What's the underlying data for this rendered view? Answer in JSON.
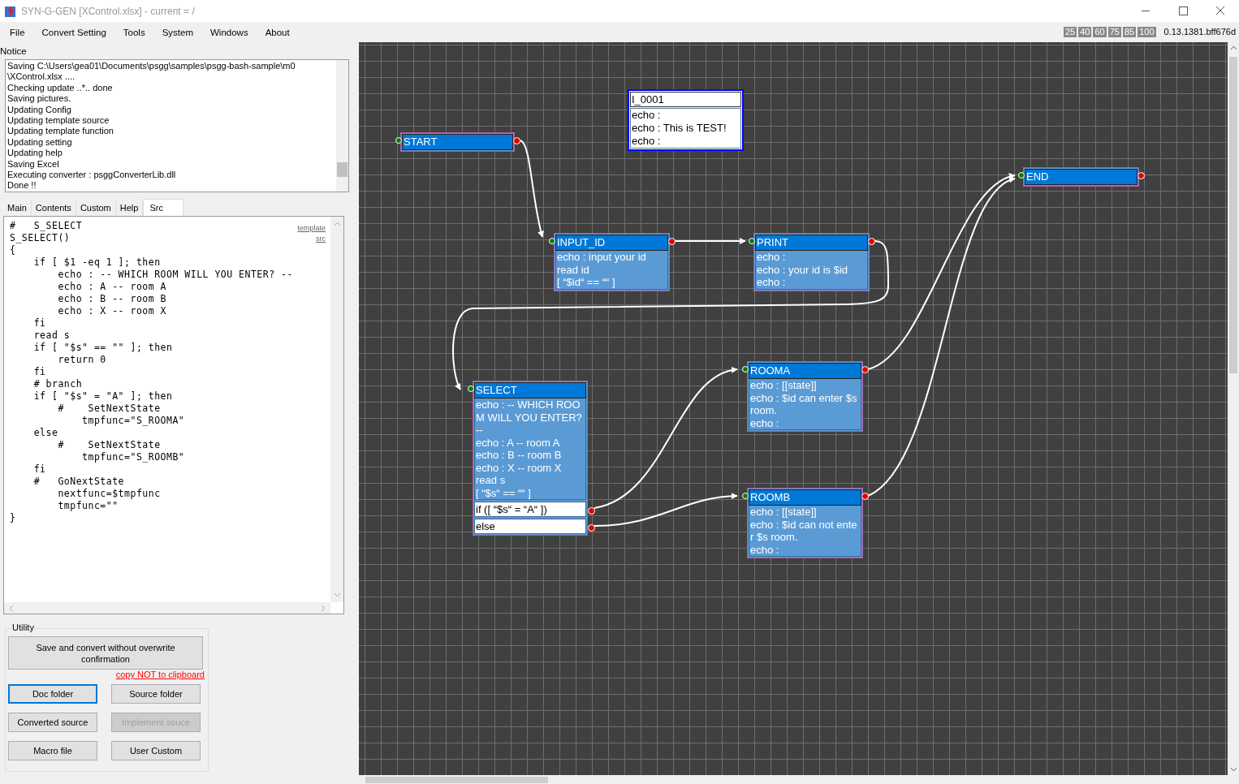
{
  "window": {
    "title": "SYN-G-GEN  [XControl.xlsx] - current = /"
  },
  "menu": [
    "File",
    "Convert Setting",
    "Tools",
    "System",
    "Windows",
    "About"
  ],
  "zoom_levels": [
    "25",
    "40",
    "60",
    "75",
    "85",
    "100"
  ],
  "version": "0.13.1381.bff676d",
  "notice": {
    "label": "Notice",
    "lines": [
      "Saving C:\\Users\\gea01\\Documents\\psgg\\samples\\psgg-bash-sample\\m0",
      "\\XControl.xlsx ....",
      "Checking update ..*.. done",
      "Saving pictures.",
      "Updating Config",
      "Updating template source",
      "Updating template function",
      "Updating setting",
      "Updating help",
      "Saving Excel",
      "Executing converter : psggConverterLib.dll",
      "Done !!"
    ]
  },
  "tabs": [
    {
      "label": "Main",
      "selected": false
    },
    {
      "label": "Contents",
      "selected": false
    },
    {
      "label": "Custom",
      "selected": false
    },
    {
      "label": "Help",
      "selected": false
    },
    {
      "label": "Src",
      "selected": true
    }
  ],
  "source": {
    "links": [
      "template",
      "src"
    ],
    "code_lines": [
      "#   S_SELECT",
      "S_SELECT()",
      "{",
      "    if [ $1 -eq 1 ]; then",
      "        echo : -- WHICH ROOM WILL YOU ENTER? --",
      "        echo : A -- room A",
      "        echo : B -- room B",
      "        echo : X -- room X",
      "    fi",
      "    read s",
      "    if [ \"$s\" == \"\" ]; then",
      "        return 0",
      "    fi",
      "    # branch",
      "    if [ \"$s\" = \"A\" ]; then",
      "        #    SetNextState",
      "            tmpfunc=\"S_ROOMA\"",
      "    else",
      "        #    SetNextState",
      "            tmpfunc=\"S_ROOMB\"",
      "    fi",
      "    #   GoNextState",
      "        nextfunc=$tmpfunc",
      "        tmpfunc=\"\"",
      "}"
    ]
  },
  "utility": {
    "label": "Utility",
    "main_button": "Save and convert without overwrite confirmation",
    "link": "copy NOT to clipboard",
    "buttons": [
      {
        "label": "Doc folder",
        "focused": true,
        "disabled": false
      },
      {
        "label": "Source folder",
        "focused": false,
        "disabled": false
      },
      {
        "label": "Converted source",
        "focused": false,
        "disabled": false
      },
      {
        "label": "Implement souce",
        "focused": false,
        "disabled": true
      },
      {
        "label": "Macro file",
        "focused": false,
        "disabled": false
      },
      {
        "label": "User Custom",
        "focused": false,
        "disabled": false
      }
    ]
  },
  "canvas": {
    "nodes": [
      {
        "kind": "terminal",
        "title": "START"
      },
      {
        "kind": "comment",
        "title": "I_0001",
        "lines": [
          "echo :",
          "echo : This is TEST!",
          "echo :"
        ]
      },
      {
        "kind": "state",
        "title": "INPUT_ID",
        "lines": [
          "echo : input your id",
          "read id",
          "[ “$id“ == ““ ]"
        ]
      },
      {
        "kind": "state",
        "title": "PRINT",
        "lines": [
          "echo :",
          "echo : your id is $id",
          "echo :"
        ]
      },
      {
        "kind": "terminal",
        "title": "END"
      },
      {
        "kind": "state",
        "title": "SELECT",
        "lines": [
          "echo : -- WHICH ROOM WILL YOU ENTER? --",
          "echo : A -- room A",
          "echo : B -- room B",
          "echo : X -- room X",
          "read s",
          "[ “$s“ == ““ ]"
        ],
        "branches": [
          "if ([ “$s“ = “A“ ])",
          "else"
        ]
      },
      {
        "kind": "state",
        "title": "ROOMA",
        "lines": [
          "echo : [[state]]",
          "echo : $id can enter $s room.",
          "echo :"
        ]
      },
      {
        "kind": "state",
        "title": "ROOMB",
        "lines": [
          "echo : [[state]]",
          "echo : $id can not enter $s room.",
          "echo :"
        ]
      }
    ]
  }
}
